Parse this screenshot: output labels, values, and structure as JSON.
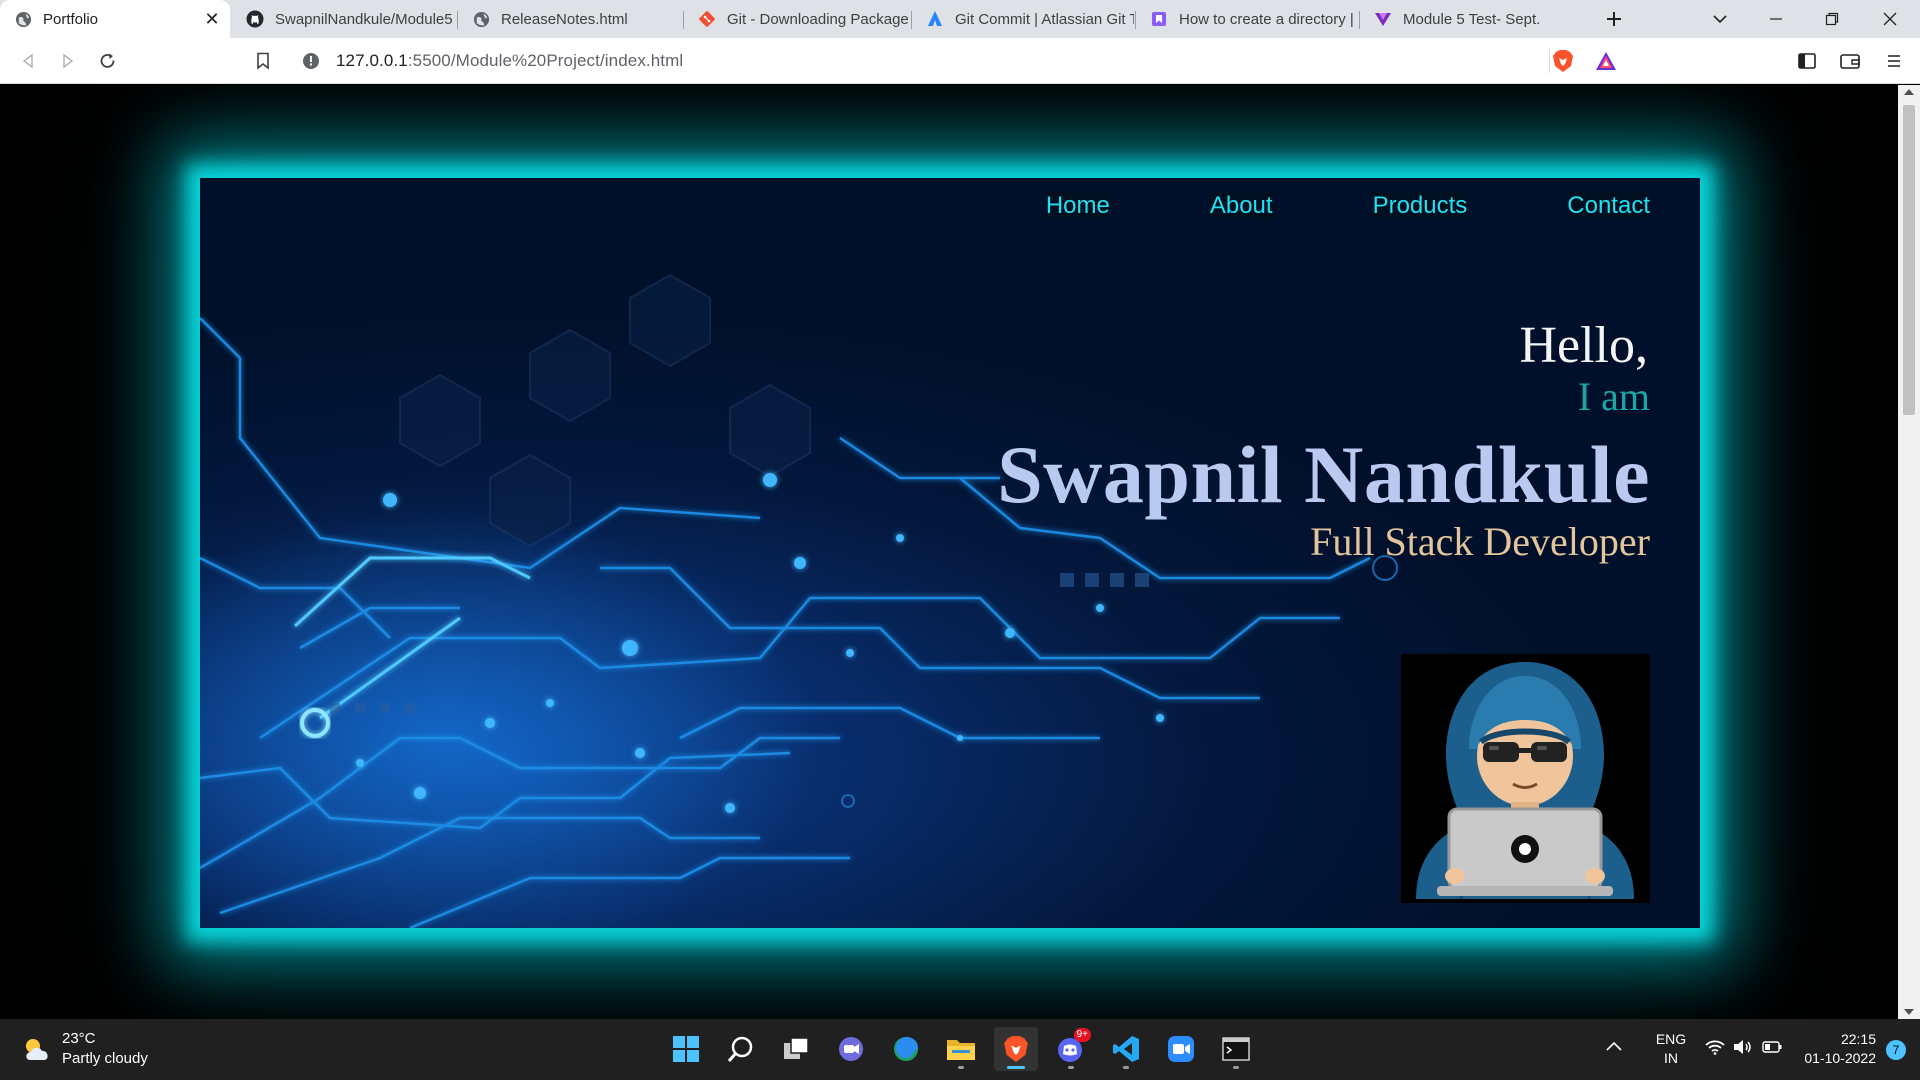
{
  "browser": {
    "tabs": [
      {
        "title": "Portfolio",
        "icon": "globe-icon",
        "active": true
      },
      {
        "title": "SwapnilNandkule/Module5",
        "icon": "github-icon"
      },
      {
        "title": "ReleaseNotes.html",
        "icon": "globe-icon"
      },
      {
        "title": "Git - Downloading Package",
        "icon": "git-icon"
      },
      {
        "title": "Git Commit | Atlassian Git T",
        "icon": "atlassian-icon"
      },
      {
        "title": "How to create a directory |",
        "icon": "bookmark-page-icon"
      },
      {
        "title": "Module 5 Test- Sept.",
        "icon": "course-icon"
      }
    ],
    "url_host": "127.0.0.1",
    "url_rest": ":5500/Module%20Project/index.html"
  },
  "page": {
    "nav": [
      "Home",
      "About",
      "Products",
      "Contact"
    ],
    "hello": "Hello,",
    "iam": "I am",
    "name": "Swapnil Nandkule",
    "role": "Full Stack Developer",
    "colors": {
      "glow": "#08d4d8",
      "nav": "#22e0f0",
      "name": "#b9c9f0",
      "role": "#e3c49c",
      "iam": "#1ba6a6"
    }
  },
  "taskbar": {
    "weather_temp": "23°C",
    "weather_desc": "Partly cloudy",
    "apps": [
      "start-icon",
      "search-icon",
      "task-view-icon",
      "chat-icon",
      "edge-icon",
      "file-explorer-icon",
      "brave-icon",
      "discord-icon",
      "vscode-icon",
      "zoom-icon",
      "terminal-icon"
    ],
    "discord_badge": "9+",
    "lang_top": "ENG",
    "lang_bottom": "IN",
    "time": "22:15",
    "date": "01-10-2022",
    "notification_count": "7"
  }
}
